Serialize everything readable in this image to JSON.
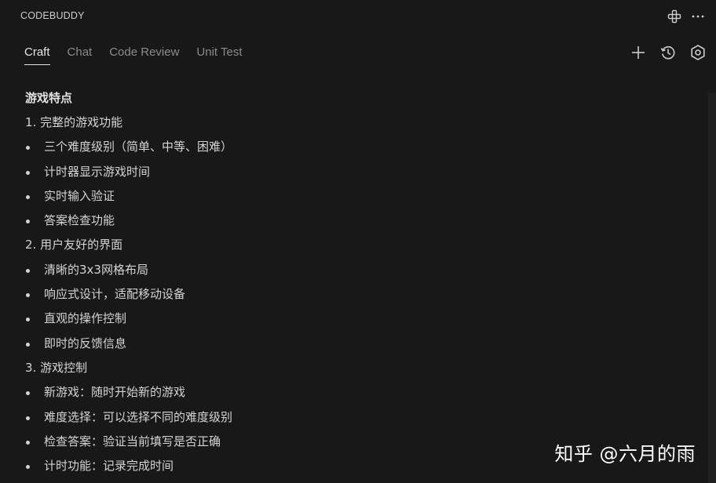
{
  "header": {
    "title": "CODEBUDDY"
  },
  "tabs": [
    {
      "label": "Craft",
      "active": true
    },
    {
      "label": "Chat",
      "active": false
    },
    {
      "label": "Code Review",
      "active": false
    },
    {
      "label": "Unit Test",
      "active": false
    }
  ],
  "icons": {
    "title_actions": [
      "extensions-icon",
      "more-icon"
    ],
    "tab_actions": [
      "plus-icon",
      "history-icon",
      "settings-icon"
    ]
  },
  "content": {
    "heading": "游戏特点",
    "sections": [
      {
        "title": "1. 完整的游戏功能",
        "items": [
          "三个难度级别（简单、中等、困难）",
          "计时器显示游戏时间",
          "实时输入验证",
          "答案检查功能"
        ]
      },
      {
        "title": "2. 用户友好的界面",
        "items": [
          "清晰的3x3网格布局",
          "响应式设计，适配移动设备",
          "直观的操作控制",
          "即时的反馈信息"
        ]
      },
      {
        "title": "3. 游戏控制",
        "items": [
          "新游戏：随时开始新的游戏",
          "难度选择：可以选择不同的难度级别",
          "检查答案：验证当前填写是否正确",
          "计时功能：记录完成时间"
        ]
      }
    ]
  },
  "watermark": "知乎 @六月的雨"
}
